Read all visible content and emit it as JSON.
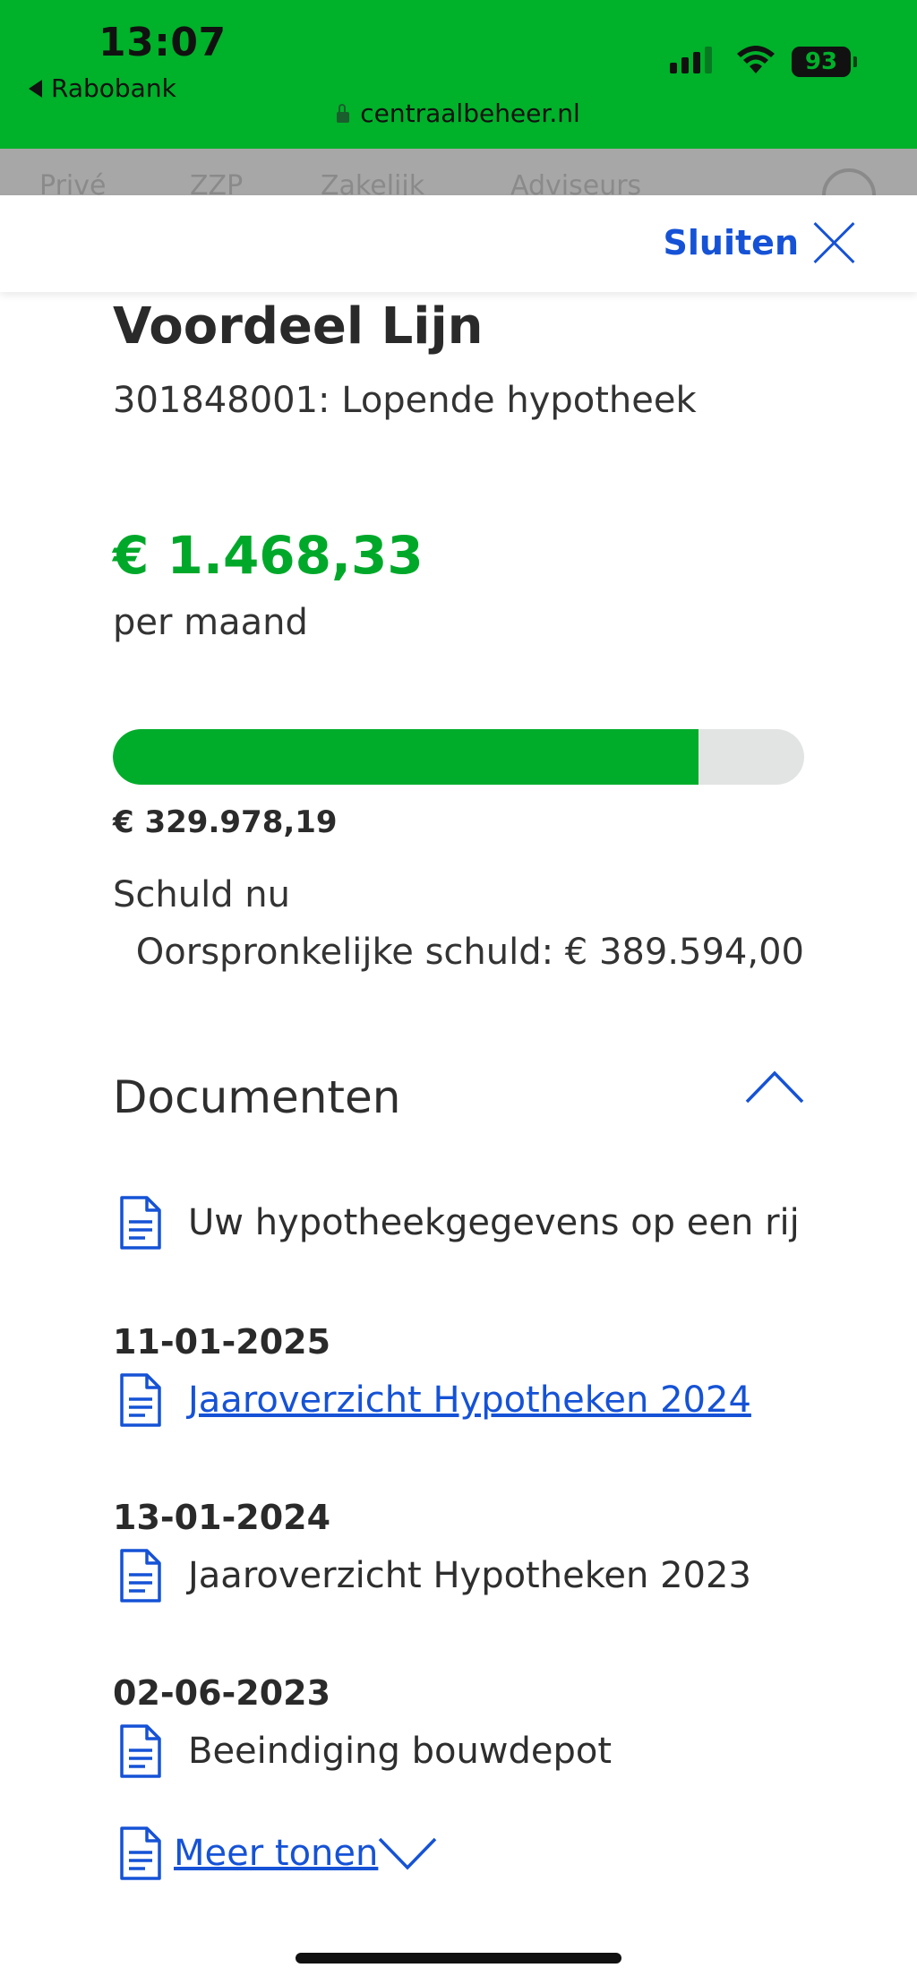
{
  "status_bar": {
    "time": "13:07",
    "back_app": "Rabobank",
    "url": "centraalbeheer.nl",
    "battery": "93"
  },
  "background_nav": [
    "Privé",
    "ZZP",
    "Zakelijk",
    "Adviseurs"
  ],
  "sheet": {
    "close_label": "Sluiten"
  },
  "mortgage": {
    "title": "Voordeel Lijn",
    "subtitle": "301848001: Lopende hypotheek",
    "monthly_amount": "€ 1.468,33",
    "monthly_label": "per maand",
    "current_debt": "€ 329.978,19",
    "current_debt_label": "Schuld nu",
    "original_debt": "Oorspronkelijke schuld: € 389.594,00",
    "progress_fraction": 0.847
  },
  "documents": {
    "heading": "Documenten",
    "overview_label": "Uw hypotheekgegevens op een rij",
    "items": [
      {
        "date": "11-01-2025",
        "label": "Jaaroverzicht Hypotheken 2024"
      },
      {
        "date": "13-01-2024",
        "label": "Jaaroverzicht Hypotheken 2023"
      },
      {
        "date": "02-06-2023",
        "label": "Beeindiging bouwdepot"
      }
    ],
    "more_label": "Meer tonen"
  },
  "colors": {
    "brand_green": "#00b12a",
    "link_blue": "#1552d6"
  }
}
